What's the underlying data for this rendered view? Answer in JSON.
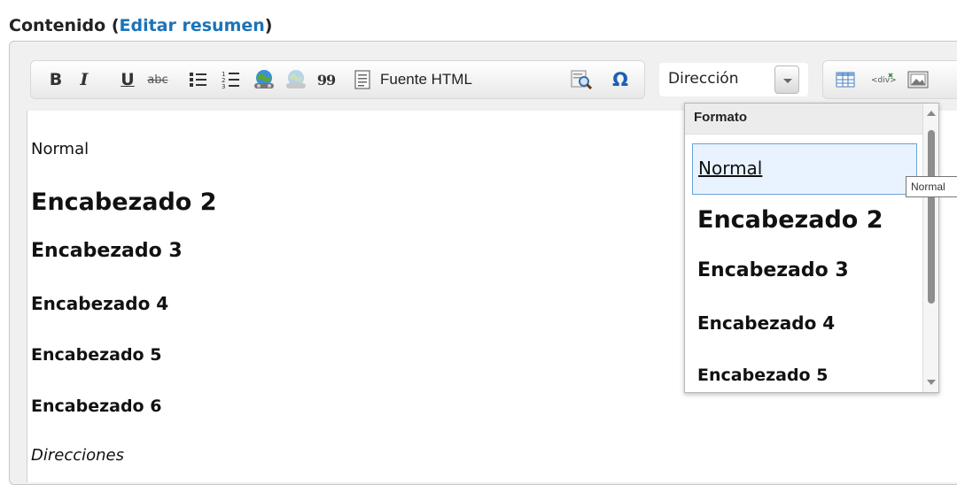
{
  "field": {
    "label": "Contenido",
    "open_paren": "(",
    "link": "Editar resumen",
    "close_paren": ")"
  },
  "toolbar": {
    "bold": "B",
    "italic": "I",
    "underline": "U",
    "strike": "abc",
    "source_label": "Fuente HTML",
    "omega": "Ω",
    "quote": "99",
    "combo_value": "Dirección",
    "icons": [
      "bold-icon",
      "italic-icon",
      "underline-icon",
      "strikethrough-icon",
      "bullet-list-icon",
      "numbered-list-icon",
      "link-icon",
      "unlink-icon",
      "blockquote-icon",
      "source-icon",
      "find-icon",
      "special-character-icon",
      "table-icon",
      "div-icon",
      "image-icon"
    ]
  },
  "content": {
    "lines": [
      "Normal",
      "Encabezado 2",
      "Encabezado 3",
      "Encabezado 4",
      "Encabezado 5",
      "Encabezado 6",
      "Direcciones"
    ]
  },
  "format_panel": {
    "title": "Formato",
    "items": [
      "Normal",
      "Encabezado 2",
      "Encabezado 3",
      "Encabezado 4",
      "Encabezado 5"
    ],
    "selected": "Normal"
  },
  "tooltip": {
    "text": "Normal"
  },
  "colors": {
    "link": "#1a73b8",
    "accent": "#4d9e2d",
    "special": "#1e5fb4",
    "selected_bg": "#e8f3ff",
    "selected_border": "#6aa2d5"
  }
}
